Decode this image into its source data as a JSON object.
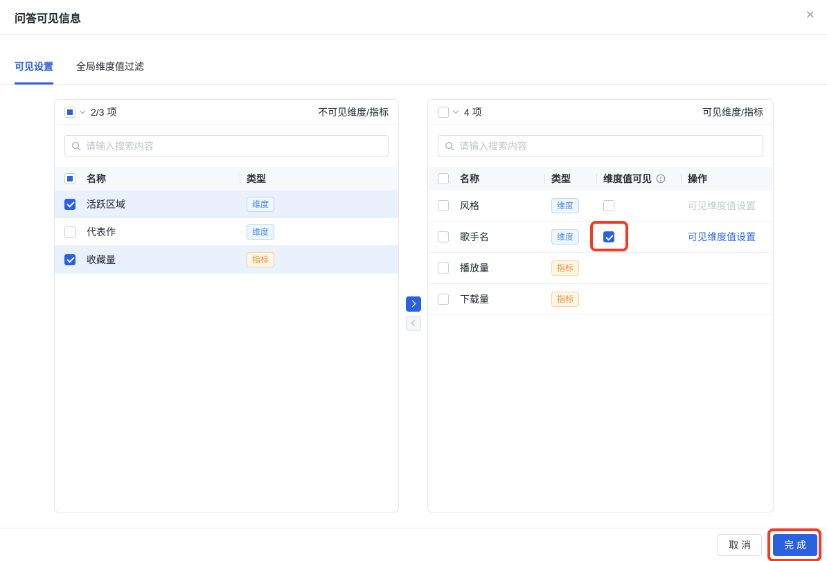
{
  "colors": {
    "primary": "#2b61e0",
    "annotation_red": "#f23a24",
    "selected_row_bg": "#e9f1fd",
    "dimension_tag": "#4d8ce0",
    "metric_tag": "#de9436"
  },
  "dialog": {
    "title": "问答可见信息",
    "close_icon": "✕"
  },
  "tabs": [
    {
      "label": "可见设置",
      "active": true
    },
    {
      "label": "全局维度值过滤",
      "active": false
    }
  ],
  "left_panel": {
    "count": "2/3 项",
    "side_title": "不可见维度/指标",
    "search_placeholder": "请输入搜索内容",
    "columns": {
      "name": "名称",
      "type": "类型"
    },
    "rows": [
      {
        "name": "活跃区域",
        "type": "维度",
        "kind": "dimension",
        "checked": true,
        "selected": true
      },
      {
        "name": "代表作",
        "type": "维度",
        "kind": "dimension",
        "checked": false,
        "selected": false
      },
      {
        "name": "收藏量",
        "type": "指标",
        "kind": "metric",
        "checked": true,
        "selected": true
      }
    ]
  },
  "transfer": {
    "move_right": "to-right",
    "move_left": "to-left"
  },
  "right_panel": {
    "count": "4 项",
    "side_title": "可见维度/指标",
    "search_placeholder": "请输入搜索内容",
    "columns": {
      "name": "名称",
      "type": "类型",
      "dim_visible": "维度值可见",
      "action": "操作"
    },
    "rows": [
      {
        "name": "风格",
        "type": "维度",
        "kind": "dimension",
        "checked": false,
        "dim_visible_checked": false,
        "action": "可见维度值设置",
        "action_state": "disabled"
      },
      {
        "name": "歌手名",
        "type": "维度",
        "kind": "dimension",
        "checked": false,
        "dim_visible_checked": true,
        "highlighted": true,
        "action": "可见维度值设置",
        "action_state": "enabled"
      },
      {
        "name": "播放量",
        "type": "指标",
        "kind": "metric",
        "checked": false
      },
      {
        "name": "下载量",
        "type": "指标",
        "kind": "metric",
        "checked": false
      }
    ]
  },
  "footer": {
    "cancel_label": "取 消",
    "confirm_label": "完 成",
    "confirm_highlighted": true
  }
}
